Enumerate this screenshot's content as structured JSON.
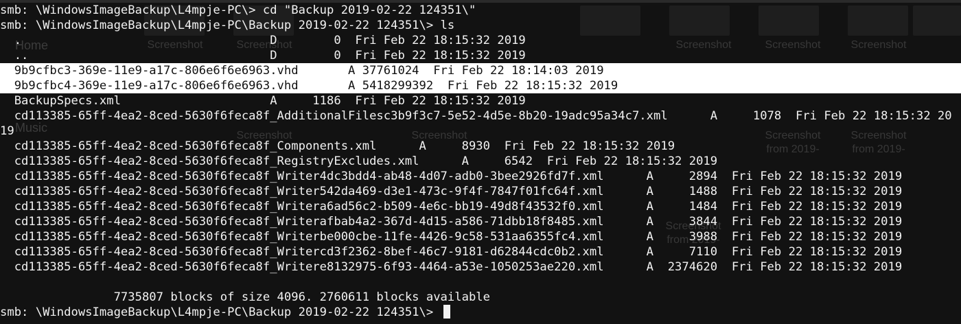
{
  "terminal": {
    "lines": [
      "smb: \\WindowsImageBackup\\L4mpje-PC\\> cd \"Backup 2019-02-22 124351\\\"",
      "smb: \\WindowsImageBackup\\L4mpje-PC\\Backup 2019-02-22 124351\\> ls",
      "  .                                   D        0  Fri Feb 22 18:15:32 2019",
      "  ..                                  D        0  Fri Feb 22 18:15:32 2019",
      "  9b9cfbc3-369e-11e9-a17c-806e6f6e6963.vhd       A 37761024  Fri Feb 22 18:14:03 2019",
      "  9b9cfbc4-369e-11e9-a17c-806e6f6e6963.vhd       A 5418299392  Fri Feb 22 18:15:32 2019",
      "  BackupSpecs.xml                     A     1186  Fri Feb 22 18:15:32 2019",
      "  cd113385-65ff-4ea2-8ced-5630f6feca8f_AdditionalFilesc3b9f3c7-5e52-4d5e-8b20-19adc95a34c7.xml      A     1078  Fri Feb 22 18:15:32 20",
      "19",
      "  cd113385-65ff-4ea2-8ced-5630f6feca8f_Components.xml      A     8930  Fri Feb 22 18:15:32 2019",
      "  cd113385-65ff-4ea2-8ced-5630f6feca8f_RegistryExcludes.xml      A     6542  Fri Feb 22 18:15:32 2019",
      "  cd113385-65ff-4ea2-8ced-5630f6feca8f_Writer4dc3bdd4-ab48-4d07-adb0-3bee2926fd7f.xml      A     2894  Fri Feb 22 18:15:32 2019",
      "  cd113385-65ff-4ea2-8ced-5630f6feca8f_Writer542da469-d3e1-473c-9f4f-7847f01fc64f.xml      A     1488  Fri Feb 22 18:15:32 2019",
      "  cd113385-65ff-4ea2-8ced-5630f6feca8f_Writera6ad56c2-b509-4e6c-bb19-49d8f43532f0.xml      A     1484  Fri Feb 22 18:15:32 2019",
      "  cd113385-65ff-4ea2-8ced-5630f6feca8f_Writerafbab4a2-367d-4d15-a586-71dbb18f8485.xml      A     3844  Fri Feb 22 18:15:32 2019",
      "  cd113385-65ff-4ea2-8ced-5630f6feca8f_Writerbe000cbe-11fe-4426-9c58-531aa6355fc4.xml      A     3988  Fri Feb 22 18:15:32 2019",
      "  cd113385-65ff-4ea2-8ced-5630f6feca8f_Writercd3f2362-8bef-46c7-9181-d62844cdc0b2.xml      A     7110  Fri Feb 22 18:15:32 2019",
      "  cd113385-65ff-4ea2-8ced-5630f6feca8f_Writere8132975-6f93-4464-a53e-1050253ae220.xml      A  2374620  Fri Feb 22 18:15:32 2019",
      "",
      "                7735807 blocks of size 4096. 2760611 blocks available",
      "smb: \\WindowsImageBackup\\L4mpje-PC\\Backup 2019-02-22 124351\\> "
    ],
    "background_ghost": {
      "sidebar": [
        "Home",
        "Music"
      ],
      "tile_caption": "Screenshot",
      "tile_caption_2": "from 2019-"
    },
    "colors": {
      "background": "#121212",
      "foreground": "#f2f2f2",
      "selection": "#ffffff"
    }
  }
}
